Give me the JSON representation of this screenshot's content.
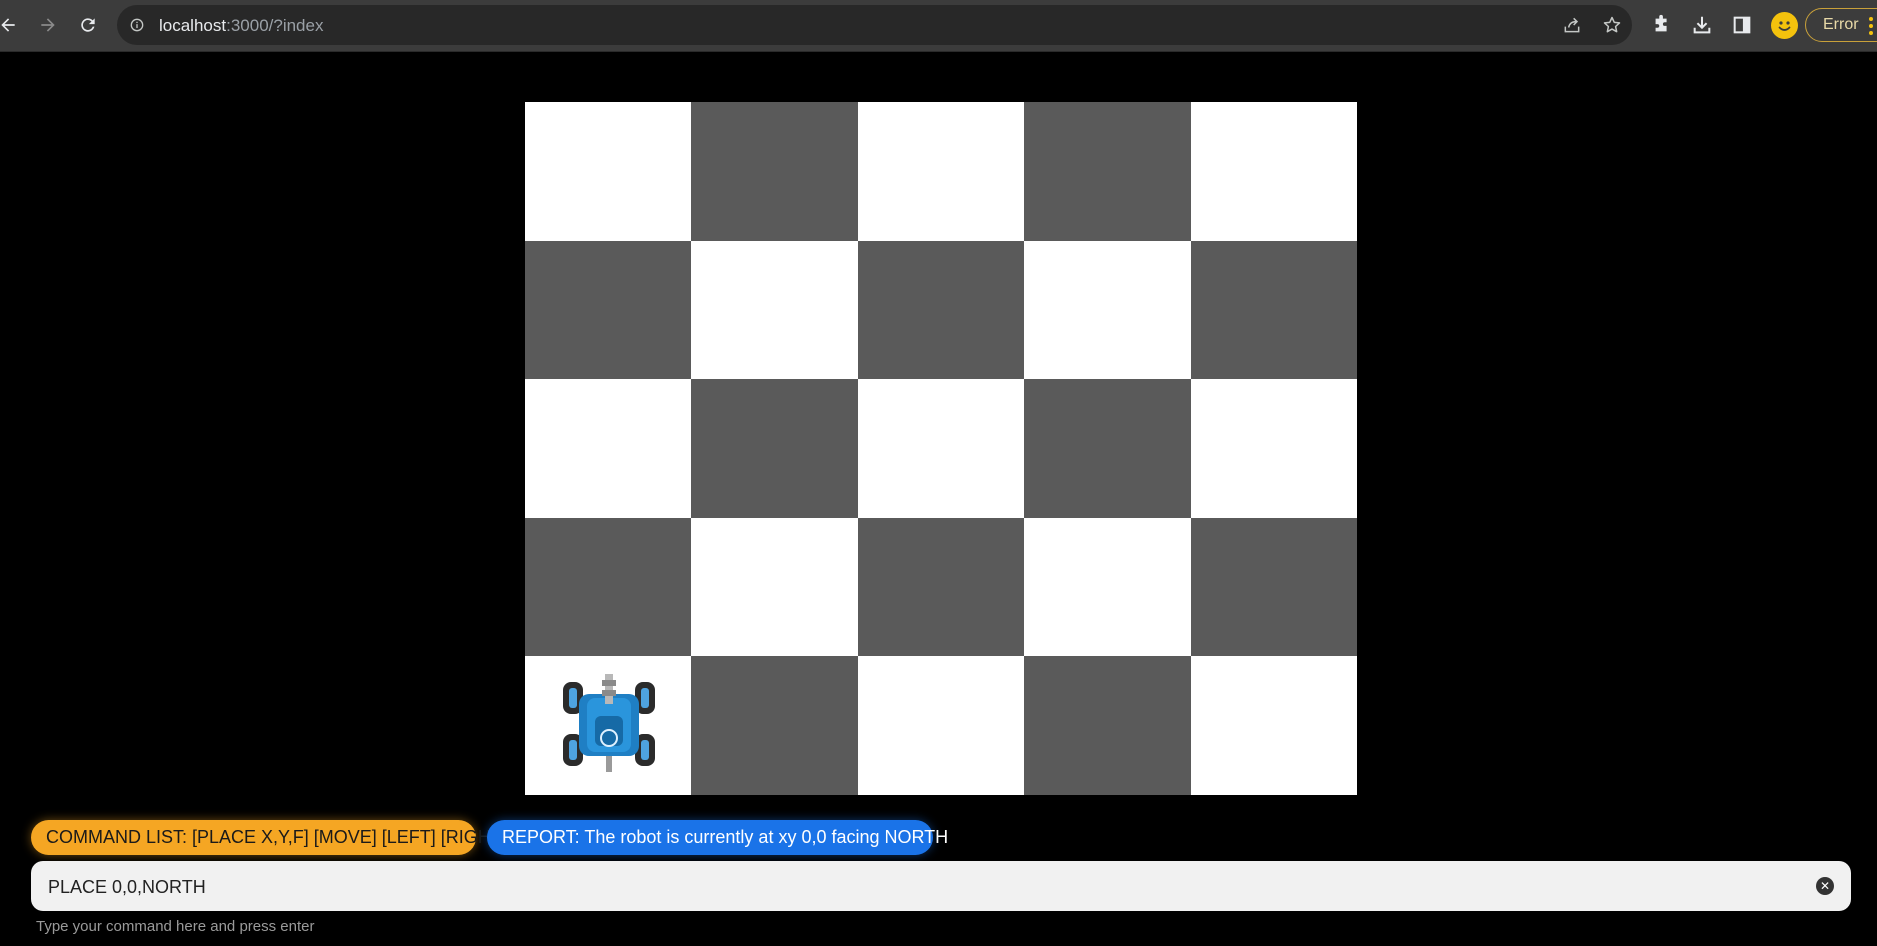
{
  "browser": {
    "url_host": "localhost",
    "url_path": ":3000/?index",
    "error_label": "Error",
    "icons": {
      "back": "back-arrow-icon",
      "forward": "forward-arrow-icon",
      "reload": "reload-icon",
      "site_info": "info-icon",
      "share": "share-icon",
      "bookmark": "star-icon",
      "extensions": "puzzle-icon",
      "downloads": "download-icon",
      "side_panel": "side-panel-icon",
      "profile": "smiley-icon",
      "menu": "kebab-menu-icon"
    }
  },
  "board": {
    "rows": 5,
    "columns": 5,
    "light_color": "#ffffff",
    "dark_color": "#5a5a5a",
    "robot": {
      "x": 0,
      "y": 0,
      "facing": "NORTH",
      "icon": "robot-icon"
    }
  },
  "commands": {
    "list_label": "COMMAND LIST: [PLACE X,Y,F] [MOVE] [LEFT] [RIGHT]",
    "list_color": "#f5a623",
    "report_label": "REPORT: The robot is currently at xy 0,0 facing NORTH",
    "report_color": "#1a73e8",
    "input_value": "PLACE 0,0,NORTH",
    "helper_text": "Type your command here and press enter"
  }
}
